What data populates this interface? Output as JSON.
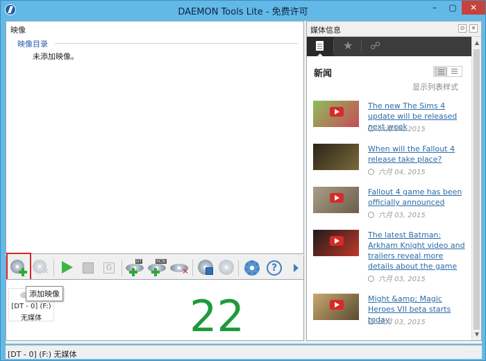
{
  "window": {
    "title": "DAEMON Tools Lite - 免费许可",
    "controls": {
      "minimize": "–",
      "maximize": "▢",
      "close": "✕"
    }
  },
  "images_panel": {
    "title": "映像",
    "catalog": "映像目录",
    "empty": "未添加映像。"
  },
  "toolbar": {
    "buttons": [
      {
        "name": "add-image",
        "icon": "disc-plus-icon"
      },
      {
        "name": "remove-image",
        "icon": "disc-x-icon"
      },
      {
        "name": "mount",
        "icon": "play-icon"
      },
      {
        "name": "unmount",
        "icon": "stop-icon"
      },
      {
        "name": "grab",
        "icon": "g-icon"
      },
      {
        "name": "add-dt-drive",
        "icon": "dt-plus-icon"
      },
      {
        "name": "add-scsi-drive",
        "icon": "scsi-plus-icon"
      },
      {
        "name": "remove-drive",
        "icon": "drive-x-icon"
      },
      {
        "name": "write-image",
        "icon": "disc-save-icon"
      },
      {
        "name": "disc",
        "icon": "disc-icon"
      },
      {
        "name": "settings",
        "icon": "gear-icon"
      },
      {
        "name": "help",
        "icon": "help-icon"
      },
      {
        "name": "more",
        "icon": "arrow-right-icon"
      }
    ],
    "dt_tag": "DT",
    "scsi_tag": "SCSI",
    "tooltip": "添加映像"
  },
  "drives": {
    "items": [
      {
        "name": "[DT - 0] (F:)",
        "status": "无媒体"
      }
    ],
    "big_number": "22"
  },
  "media_panel": {
    "title": "媒体信息",
    "ctrl_pin": "⊙",
    "ctrl_close": "✕",
    "news_title": "新闻",
    "view_label": "显示列表样式",
    "news": [
      {
        "title": "The new The Sims 4 update will be released next week",
        "date": "六月 04, 2015",
        "thumb_colors": [
          "#8bbf5a",
          "#c84a58"
        ]
      },
      {
        "title": "When will the Fallout 4 release take place?",
        "date": "六月 04, 2015",
        "thumb_colors": [
          "#2b2417",
          "#7a6a3c"
        ]
      },
      {
        "title": "Fallout 4 game has been officially announced",
        "date": "六月 03, 2015",
        "thumb_colors": [
          "#a89d88",
          "#6b5f4a"
        ]
      },
      {
        "title": "The latest Batman: Arkham Knight video and trailers reveal more details about the game",
        "date": "六月 03, 2015",
        "thumb_colors": [
          "#1e1a1a",
          "#c0382a"
        ]
      },
      {
        "title": "Might &amp; Magic Heroes VII beta starts today",
        "date": "六月 03, 2015",
        "thumb_colors": [
          "#c8a870",
          "#5a4a30"
        ]
      }
    ]
  },
  "statusbar": {
    "text": "[DT - 0] (F:) 无媒体"
  }
}
